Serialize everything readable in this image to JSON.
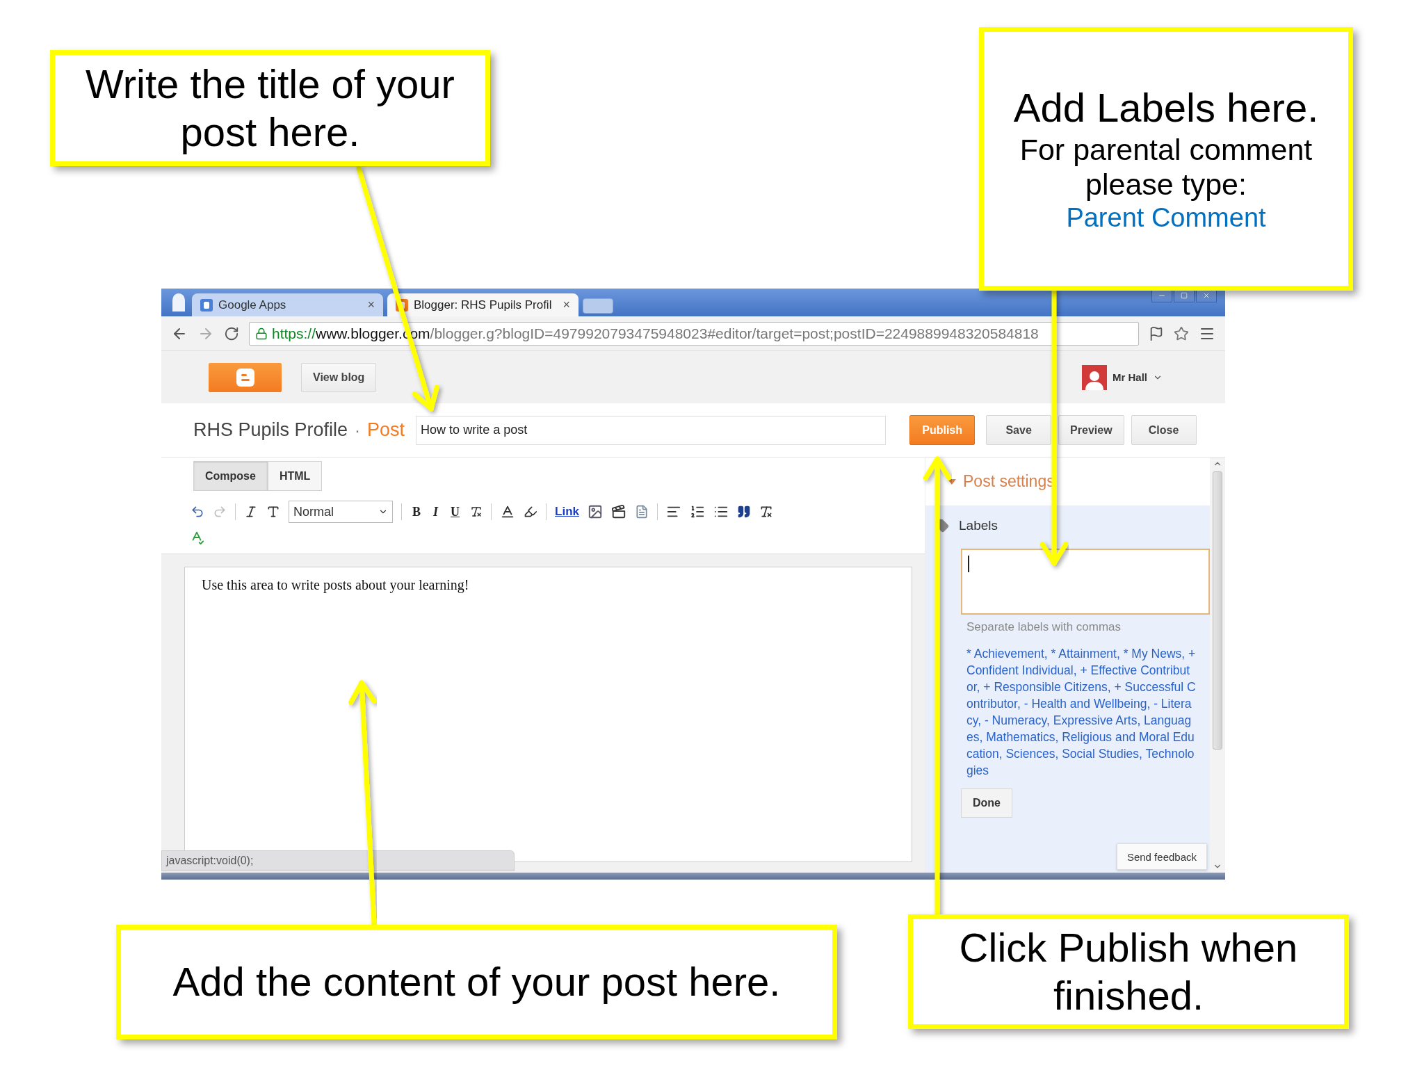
{
  "browser": {
    "tabs": [
      {
        "title": "Google Apps",
        "close": "×",
        "selected": false
      },
      {
        "title": "Blogger: RHS Pupils Profil",
        "close": "×",
        "selected": true
      }
    ],
    "url": {
      "scheme": "https://",
      "host": "www.blogger.com",
      "path": "/blogger.g?blogID=4979920793475948023#editor/target=post;postID=2249889948320584818"
    }
  },
  "header": {
    "view_blog": "View blog",
    "user": "Mr Hall"
  },
  "post": {
    "blog_name": "RHS Pupils Profile",
    "separator": "·",
    "section": "Post",
    "title_value": "How to write a post",
    "buttons": [
      {
        "label": "Publish",
        "kind": "primary"
      },
      {
        "label": "Save",
        "kind": "default"
      },
      {
        "label": "Preview",
        "kind": "default"
      },
      {
        "label": "Close",
        "kind": "default"
      }
    ]
  },
  "editor": {
    "modes": [
      {
        "label": "Compose",
        "selected": true
      },
      {
        "label": "HTML",
        "selected": false
      }
    ],
    "toolbar": {
      "format": "Normal",
      "bold": "B",
      "italic": "I",
      "underline": "U",
      "link": "Link"
    },
    "body": "Use this area to write posts about your learning!"
  },
  "status_bar": "javascript:void(0);",
  "settings": {
    "title": "Post settings",
    "labels": {
      "heading": "Labels",
      "hint": "Separate labels with commas",
      "suggestions": "* Achievement, * Attainment, * My News, + Confident Individual, + Effective Contributor, + Responsible Citizens, + Successful Contributor, - Health and Wellbeing, - Literacy, - Numeracy, Expressive Arts, Languages, Mathematics, Religious and Moral Education, Sciences, Social Studies, Technologies",
      "done": "Done"
    },
    "feedback": "Send feedback"
  },
  "callouts": [
    {
      "texts": [
        {
          "kind": "heading",
          "text": "Write the title of your post here."
        }
      ]
    },
    {
      "texts": [
        {
          "kind": "heading",
          "text": "Add Labels here."
        },
        {
          "kind": "body",
          "text": "For parental comment please type:"
        },
        {
          "kind": "highlight",
          "text": "Parent Comment"
        }
      ]
    },
    {
      "texts": [
        {
          "kind": "heading",
          "text": "Add the content of your post here."
        }
      ]
    },
    {
      "texts": [
        {
          "kind": "heading",
          "text": "Click Publish when finished."
        }
      ]
    }
  ]
}
